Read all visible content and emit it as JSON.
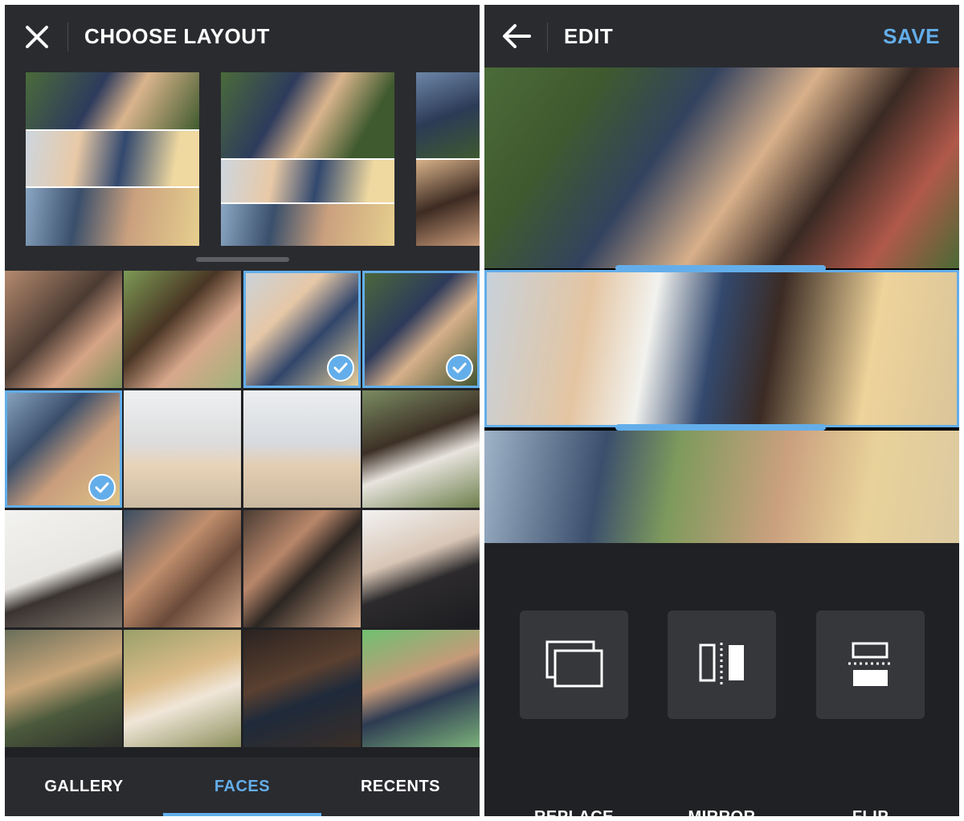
{
  "left": {
    "title": "CHOOSE LAYOUT",
    "close_icon": "close-icon",
    "layouts": [
      "layout-three-rows",
      "layout-two-top-rows",
      "layout-split-columns"
    ],
    "tabs": [
      {
        "label": "GALLERY",
        "active": false
      },
      {
        "label": "FACES",
        "active": true
      },
      {
        "label": "RECENTS",
        "active": false
      }
    ],
    "selected_count": 3
  },
  "right": {
    "title": "EDIT",
    "back_icon": "arrow-left-icon",
    "save_label": "SAVE",
    "tools": [
      {
        "label": "REPLACE",
        "icon": "replace-icon"
      },
      {
        "label": "MIRROR",
        "icon": "mirror-icon"
      },
      {
        "label": "FLIP",
        "icon": "flip-icon"
      }
    ]
  },
  "colors": {
    "accent": "#63aeea",
    "background": "#202124",
    "bar": "#2a2b2f",
    "tool_tile": "#36373b",
    "text": "#ffffff"
  }
}
